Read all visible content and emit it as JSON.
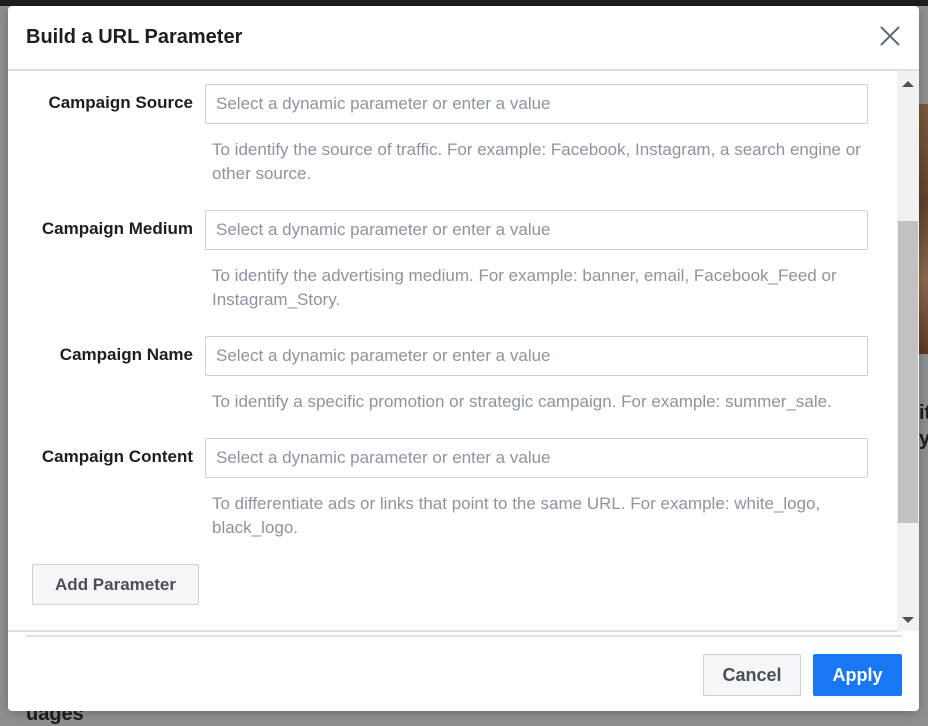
{
  "modal": {
    "title": "Build a URL Parameter",
    "close_icon": "close-icon"
  },
  "parameters": [
    {
      "label": "Campaign Source",
      "placeholder": "Select a dynamic parameter or enter a value",
      "value": "",
      "help": "To identify the source of traffic. For example: Facebook, Instagram, a search engine or other source."
    },
    {
      "label": "Campaign Medium",
      "placeholder": "Select a dynamic parameter or enter a value",
      "value": "",
      "help": "To identify the advertising medium. For example: banner, email, Facebook_Feed or Instagram_Story."
    },
    {
      "label": "Campaign Name",
      "placeholder": "Select a dynamic parameter or enter a value",
      "value": "",
      "help": "To identify a specific promotion or strategic campaign. For example: summer_sale."
    },
    {
      "label": "Campaign Content",
      "placeholder": "Select a dynamic parameter or enter a value",
      "value": "",
      "help": "To differentiate ads or links that point to the same URL. For example: white_logo, black_logo."
    }
  ],
  "add_parameter_label": "Add Parameter",
  "footer": {
    "cancel_label": "Cancel",
    "apply_label": "Apply"
  },
  "background": {
    "right_text": "it y",
    "bottom_text": "uages"
  },
  "colors": {
    "primary": "#1877f2",
    "help_text": "#8d949e",
    "label_text": "#1c1e21"
  }
}
